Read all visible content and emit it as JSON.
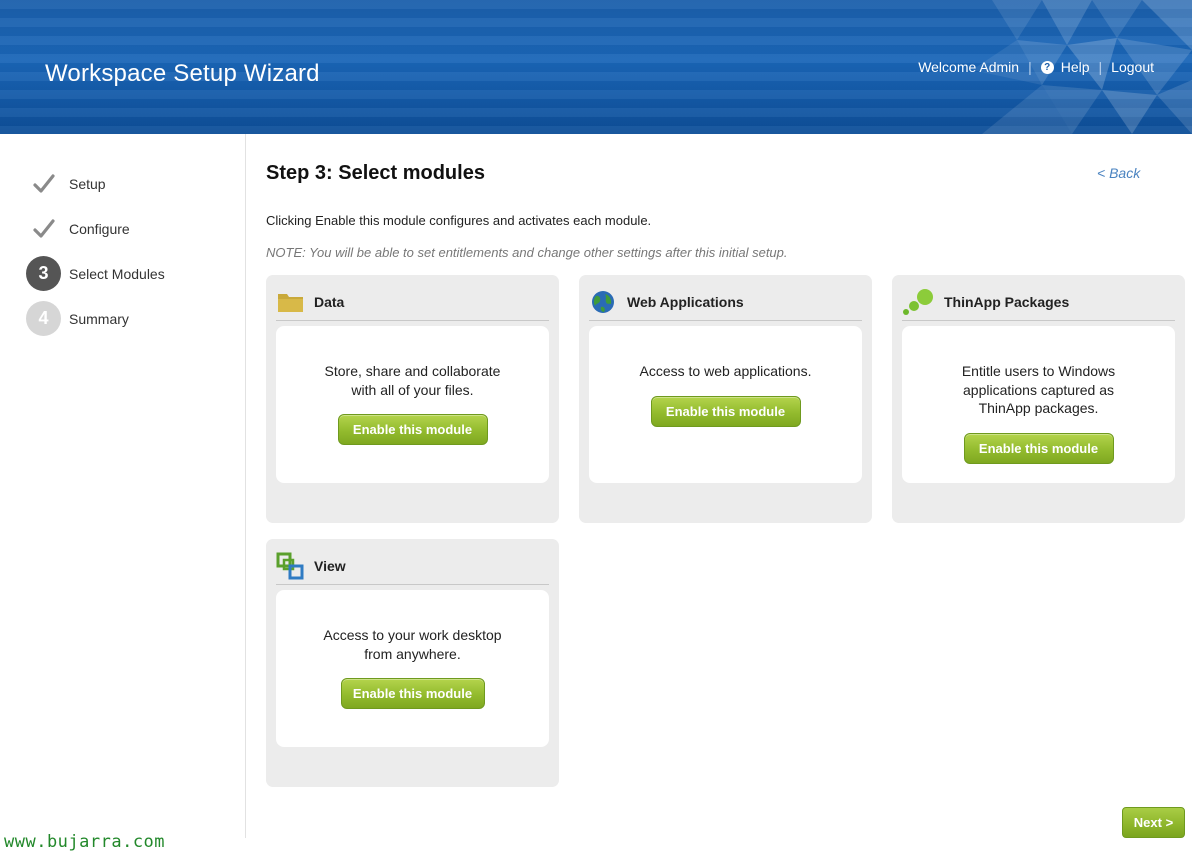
{
  "header": {
    "app_title": "Workspace Setup Wizard",
    "welcome": "Welcome Admin",
    "help_label": "Help",
    "logout_label": "Logout",
    "separator": "|"
  },
  "steps": [
    {
      "label": "Setup",
      "state": "done"
    },
    {
      "label": "Configure",
      "state": "done"
    },
    {
      "label": "Select Modules",
      "number": "3",
      "state": "active"
    },
    {
      "label": "Summary",
      "number": "4",
      "state": "pending"
    }
  ],
  "main": {
    "title": "Step 3: Select modules",
    "back_label": "< Back",
    "intro": "Clicking Enable this module configures and activates each module.",
    "note": "NOTE: You will be able to set entitlements and change other settings after this initial setup."
  },
  "modules": [
    {
      "title": "Data",
      "icon": "folder-icon",
      "description": "Store, share and collaborate with all of your files.",
      "button": "Enable this module"
    },
    {
      "title": "Web Applications",
      "icon": "globe-icon",
      "description": "Access to web applications.",
      "button": "Enable this module"
    },
    {
      "title": "ThinApp Packages",
      "icon": "thinapp-bubbles-icon",
      "description": "Entitle users to Windows applications captured as ThinApp packages.",
      "button": "Enable this module"
    },
    {
      "title": "View",
      "icon": "view-squares-icon",
      "description": "Access to your work desktop from anywhere.",
      "button": "Enable this module"
    }
  ],
  "next_label": "Next >",
  "watermark": "www.bujarra.com",
  "colors": {
    "header_blue": "#1a66b8",
    "button_green": "#93bb2e",
    "link_blue": "#4a83c0",
    "active_step": "#555555",
    "inactive_step": "#d6d6d6"
  }
}
